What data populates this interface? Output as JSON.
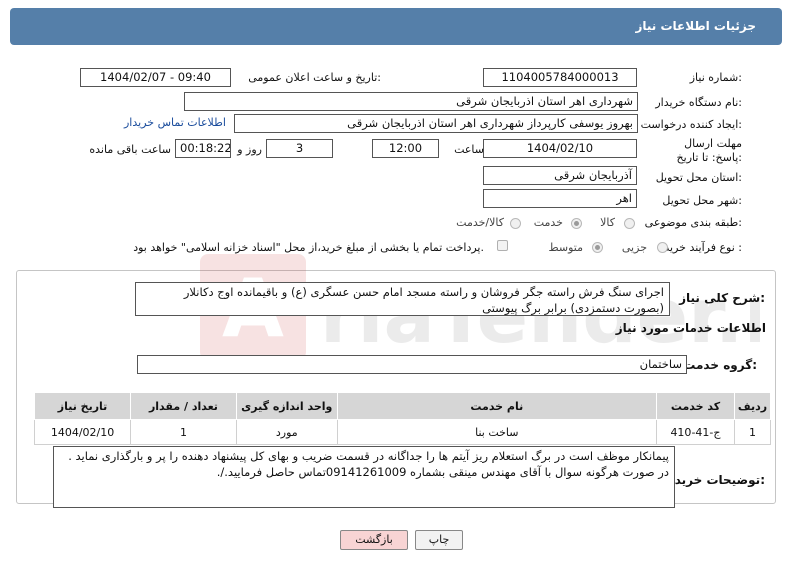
{
  "header": {
    "title": "جزئیات اطلاعات نیاز"
  },
  "fields": {
    "need_number": {
      "label": "شماره نیاز:",
      "value": "1104005784000013"
    },
    "announce_datetime": {
      "label": "تاریخ و ساعت اعلان عمومی:",
      "value": "1404/02/07 - 09:40"
    },
    "buyer_org": {
      "label": "نام دستگاه خریدار:",
      "value": "شهرداری اهر استان اذربایجان شرقی"
    },
    "requester": {
      "label": "ایجاد کننده درخواست:",
      "value": "بهروز یوسفی کارپرداز شهرداری اهر استان اذربایجان شرقی"
    },
    "contact_link": "اطلاعات تماس خریدار",
    "deadline": {
      "label": "مهلت ارسال پاسخ: تا تاریخ:",
      "date": "1404/02/10",
      "time_label": "ساعت",
      "time": "12:00",
      "days": "3",
      "days_label": "روز و",
      "remaining": "00:18:22",
      "remaining_label": "ساعت باقی مانده"
    },
    "delivery_province": {
      "label": "استان محل تحویل:",
      "value": "آذربایجان شرقی"
    },
    "delivery_city": {
      "label": "شهر محل تحویل:",
      "value": "اهر"
    },
    "category": {
      "label": "طبقه بندی موضوعی:",
      "options": [
        "کالا",
        "خدمت",
        "کالا/خدمت"
      ],
      "selected": "خدمت"
    },
    "process_type": {
      "label": "نوع فرآیند خرید :",
      "options": [
        "جزیی",
        "متوسط"
      ],
      "selected": "متوسط",
      "payment_note": "پرداخت تمام یا بخشی از مبلغ خرید،از محل \"اسناد خزانه اسلامی\" خواهد بود."
    }
  },
  "summary": {
    "label": "شرح کلی نیاز:",
    "value": "اجرای سنگ فرش راسته جگر فروشان و راسته مسجد امام حسن عسگری (ع) و باقیمانده اوج دکانلار (بصورت دستمزدی) برابر برگ پیوستی"
  },
  "services": {
    "section_title": "اطلاعات خدمات مورد نیاز",
    "group_label": "گروه خدمت:",
    "group_value": "ساختمان",
    "columns": [
      "ردیف",
      "کد خدمت",
      "نام خدمت",
      "واحد اندازه گیری",
      "تعداد / مقدار",
      "تاریخ نیاز"
    ],
    "rows": [
      {
        "row": "1",
        "code": "ج-41-410",
        "name": "ساخت بنا",
        "unit": "مورد",
        "qty": "1",
        "date": "1404/02/10"
      }
    ]
  },
  "buyer_notes": {
    "label": "توضیحات خریدار:",
    "value": "پیمانکار موظف است در برگ استعلام ریز آیتم ها را جداگانه در قسمت ضریب و بهای کل پیشنهاد دهنده را پر و بارگذاری نماید . در صورت هرگونه سوال با آقای مهندس مینقی بشماره 09141261009تماس حاصل فرمایید./."
  },
  "buttons": {
    "print": "چاپ",
    "back": "بازگشت"
  },
  "watermark": "AriaTender.net",
  "colors": {
    "header": "#557fa9",
    "back_button": "#f8d4d4",
    "link": "#1a4c9c"
  }
}
